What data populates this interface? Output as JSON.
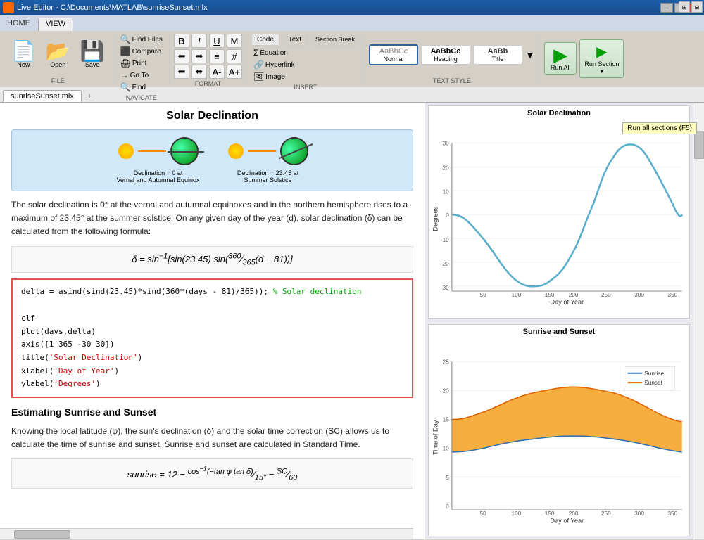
{
  "titlebar": {
    "title": "Live Editor - C:\\Documents\\MATLAB\\sunriseSunset.mlx",
    "minimize": "─",
    "maximize": "□",
    "close": "✕"
  },
  "ribbon": {
    "tabs": [
      "HOME",
      "VIEW"
    ],
    "active_tab": "VIEW",
    "groups": {
      "file": {
        "label": "FILE",
        "new": "New",
        "open": "Open",
        "save": "Save"
      },
      "navigate": {
        "label": "NAVIGATE",
        "find_files": "Find Files",
        "compare": "Compare",
        "print": "Print",
        "go_to": "Go To",
        "find": "Find"
      },
      "format": {
        "label": "FORMAT",
        "bold": "B",
        "italic": "I",
        "underline": "U",
        "strikethrough": "M"
      },
      "insert": {
        "label": "INSERT",
        "code": "Code",
        "text": "Text",
        "section_break": "Section Break",
        "equation": "Equation",
        "hyperlink": "Hyperlink",
        "image": "Image"
      },
      "text_style": {
        "label": "TEXT STYLE",
        "normal": "Normal",
        "heading": "Heading",
        "title": "Title"
      },
      "run": {
        "label": "",
        "run_all": "Run All",
        "run_section": "Run Section",
        "tooltip": "Run all sections (F5)"
      }
    }
  },
  "tab": {
    "name": "sunriseSunset.mlx",
    "add": "+"
  },
  "content": {
    "solar_declination": {
      "title": "Solar Declination",
      "caption1": "Declination = 0 at\nVernal and Autumnal Equinox",
      "caption2": "Declination = 23.45 at\nSummer Solstice",
      "description": "The solar declination is 0° at the vernal and autumnal equinoxes and in the northern hemisphere rises to a maximum of 23.45° at the summer solstice. On any given day of the year (d), solar declination (δ) can be calculated from the following formula:",
      "formula": "δ = sin⁻¹[sin(23.45) sin(360/365(d − 81))]",
      "code": [
        "delta = asind(sind(23.45)*sind(360*(days - 81)/365));",
        "",
        "clf",
        "plot(days,delta)",
        "axis([1 365 -30 30])",
        "title('Solar Declination')",
        "xlabel('Day of Year')",
        "ylabel('Degrees')"
      ],
      "code_comment": "% Solar declination"
    },
    "sunrise_sunset": {
      "heading": "Estimating Sunrise and Sunset",
      "description": "Knowing the local latitude (φ), the sun's declination (δ) and the solar time correction (SC) allows us to calculate the time of sunrise and sunset. Sunrise and sunset are calculated in Standard Time.",
      "formula": "sunrise = 12 − cos⁻¹(−tan φ tan δ) / 15° − SC/60"
    }
  },
  "chart1": {
    "title": "Solar Declination",
    "x_label": "Day of Year",
    "y_label": "Degrees",
    "x_ticks": [
      "50",
      "100",
      "150",
      "200",
      "250",
      "300",
      "350"
    ],
    "y_ticks": [
      "30",
      "20",
      "10",
      "0",
      "-10",
      "-20",
      "-30"
    ]
  },
  "chart2": {
    "title": "Sunrise and Sunset",
    "x_label": "Day of Year",
    "y_label": "Time of Day",
    "legend": {
      "sunrise": "Sunrise",
      "sunset": "Sunset"
    },
    "x_ticks": [
      "50",
      "100",
      "150",
      "200",
      "250",
      "300",
      "350"
    ],
    "y_ticks": [
      "25",
      "20",
      "15",
      "10",
      "5",
      "0"
    ]
  }
}
